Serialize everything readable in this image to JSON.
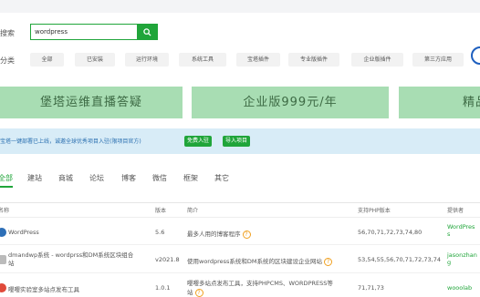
{
  "search": {
    "label": "应用搜索",
    "value": "wordpress"
  },
  "categories": {
    "label": "应用分类",
    "items": [
      "全部",
      "已安装",
      "运行环境",
      "系统工具",
      "宝塔插件",
      "专业版插件",
      "企业版插件",
      "第三方应用"
    ]
  },
  "banners": [
    "堡塔运维直播答疑",
    "企业版999元/年",
    "精品"
  ],
  "notice": {
    "text": "宝塔一键部署已上线，诚邀全球优秀项目入驻(限项目官方)",
    "tag1": "免费入驻",
    "tag2": "导入项目"
  },
  "tabs": [
    "全部",
    "建站",
    "商城",
    "论坛",
    "博客",
    "微信",
    "框架",
    "其它"
  ],
  "table": {
    "headers": {
      "name": "名称",
      "version": "版本",
      "desc": "简介",
      "php": "支持PHP版本",
      "provider": "提供者"
    },
    "rows": [
      {
        "name": "WordPress",
        "version": "5.6",
        "desc": "最多人用的博客程序",
        "php": "56,70,71,72,73,74,80",
        "provider_l1": "WordPres",
        "provider_l2": "s"
      },
      {
        "name_l1": "dmandwp系统 - wordprss和DM系统区块组合",
        "name_l2": "站",
        "version": "v2021.8",
        "desc": "使用wordpress系统和DM系统的区块建设企业网站",
        "php": "53,54,55,56,70,71,72,73,74",
        "provider_l1": "jasonzhan",
        "provider_l2": "g"
      },
      {
        "name": "嘤嘤实验室多站点发布工具",
        "version": "1.0.1",
        "desc_l1": "嘤嘤多站点发布工具，支持PHPCMS、WORDPRESS等",
        "desc_l2": "站",
        "php": "71,71,73",
        "provider": "wooolab"
      }
    ],
    "help_glyph": "?"
  },
  "colors": {
    "accent": "#20a53a",
    "banner": "#a8ddb3",
    "notice": "#d8ecf7"
  }
}
